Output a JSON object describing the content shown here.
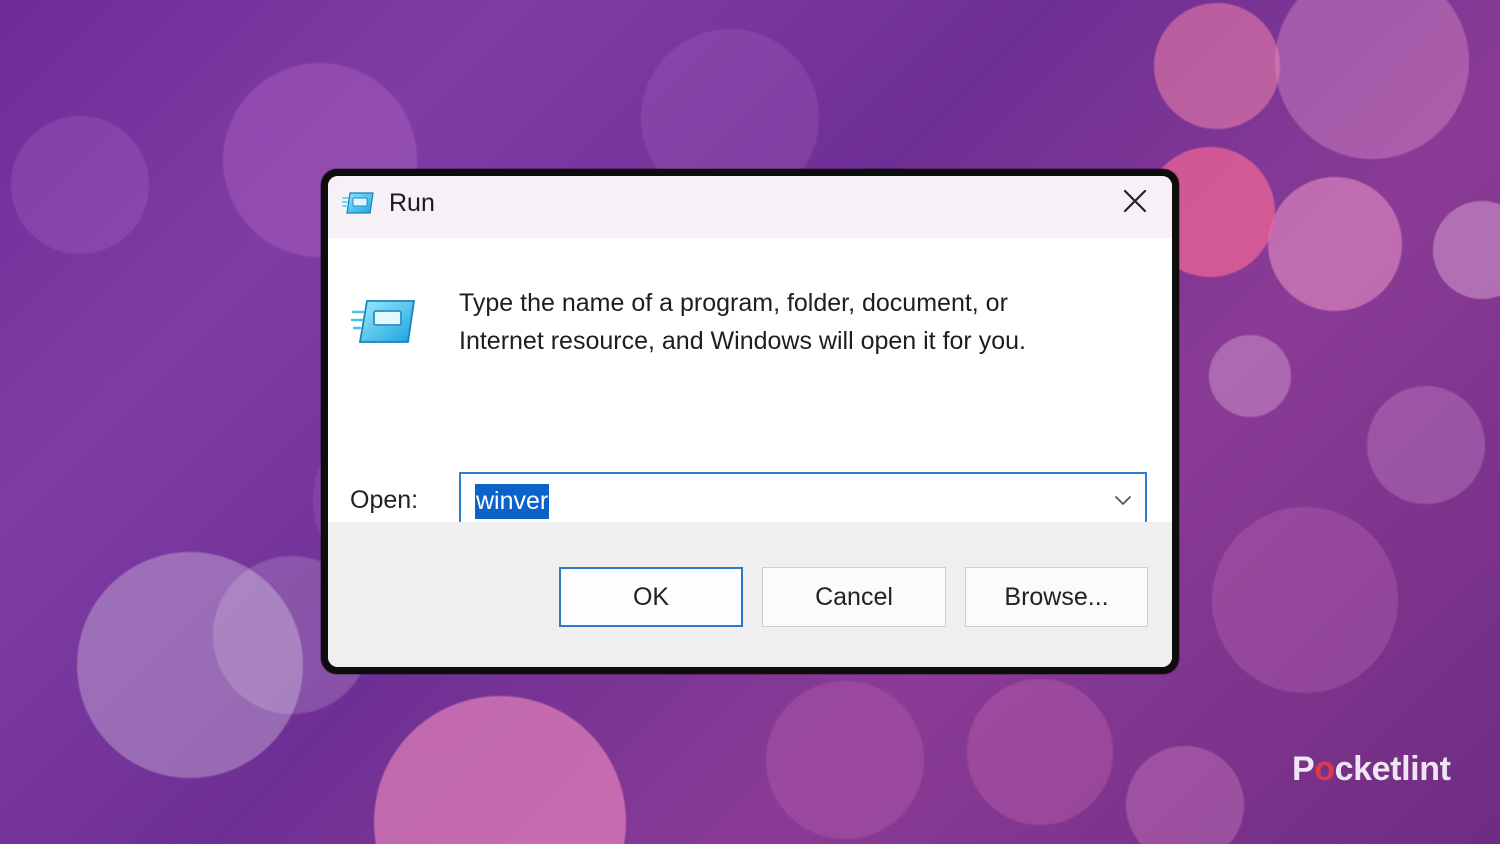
{
  "window": {
    "title": "Run",
    "close_icon": "close-icon",
    "app_icon": "run-icon"
  },
  "content": {
    "description_lines": [
      "Type the name of a program, folder, document, or",
      "Internet resource, and Windows will open it for you."
    ],
    "open_label": "Open:",
    "input_value": "winver",
    "dropdown_icon": "chevron-down-icon"
  },
  "buttons": {
    "ok": "OK",
    "cancel": "Cancel",
    "browse": "Browse..."
  },
  "watermark": {
    "part1": "P",
    "part2": "o",
    "part3": "cketlint"
  },
  "colors": {
    "selection": "#0b63c9",
    "focus_border": "#2f7fd0",
    "background_primary": "#7f3da4",
    "watermark_accent": "#d93b4b"
  }
}
